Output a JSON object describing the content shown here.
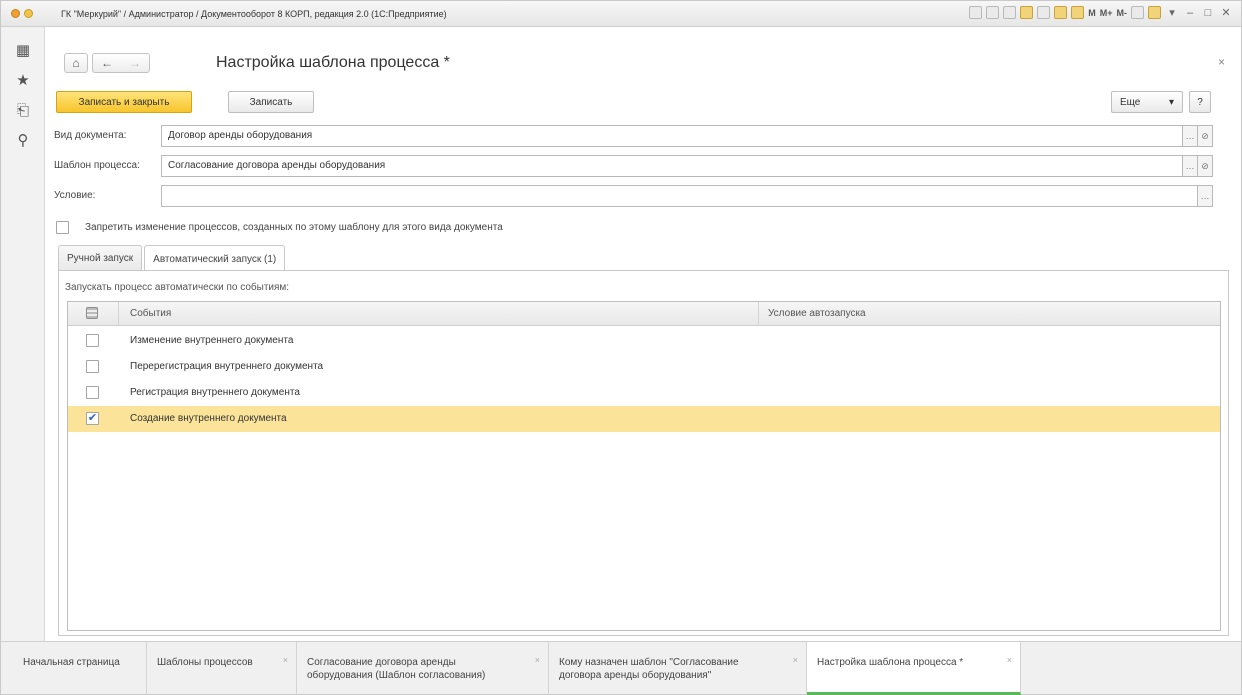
{
  "window": {
    "title": "ГК \"Меркурий\" / Администратор / Документооборот 8 КОРП, редакция 2.0 (1С:Предприятие)",
    "toolbar_labels": [
      "M",
      "M+",
      "M-"
    ]
  },
  "sidebar": {
    "items": [
      {
        "name": "apps-grid-icon",
        "glyph": "▦"
      },
      {
        "name": "favorites-star-icon",
        "glyph": "★"
      },
      {
        "name": "history-icon",
        "glyph": "⎗"
      },
      {
        "name": "search-icon",
        "glyph": "⚲"
      }
    ]
  },
  "form": {
    "title": "Настройка шаблона процесса *",
    "save_close_label": "Записать и закрыть",
    "save_label": "Записать",
    "more_label": "Еще",
    "help_label": "?",
    "fields": {
      "doc_type_label": "Вид документа:",
      "doc_type_value": "Договор аренды оборудования",
      "template_label": "Шаблон процесса:",
      "template_value": "Согласование договора аренды оборудования",
      "condition_label": "Условие:",
      "condition_value": ""
    },
    "forbid_checkbox_label": "Запретить изменение процессов, созданных по этому шаблону для этого вида документа",
    "tabs": [
      {
        "label": "Ручной запуск"
      },
      {
        "label": "Автоматический запуск (1)"
      }
    ],
    "panel_caption": "Запускать процесс автоматически по событиям:",
    "grid": {
      "columns": [
        "События",
        "Условие автозапуска"
      ],
      "rows": [
        {
          "event": "Изменение внутреннего документа",
          "checked": false,
          "selected": false
        },
        {
          "event": "Перерегистрация внутреннего документа",
          "checked": false,
          "selected": false
        },
        {
          "event": "Регистрация внутреннего документа",
          "checked": false,
          "selected": false
        },
        {
          "event": "Создание внутреннего документа",
          "checked": true,
          "selected": true
        }
      ]
    }
  },
  "taskbar": {
    "tabs": [
      {
        "label": "Начальная страница",
        "active": false
      },
      {
        "label": "Шаблоны процессов",
        "active": false
      },
      {
        "label": "Согласование договора аренды оборудования (Шаблон согласования)",
        "active": false
      },
      {
        "label": "Кому назначен шаблон \"Согласование договора аренды оборудования\"",
        "active": false
      },
      {
        "label": "Настройка шаблона процесса *",
        "active": true
      }
    ]
  },
  "colors": {
    "primary_button": "#f7c52b",
    "selected_row": "#fbe49a",
    "active_tab_underline": "#58b95a"
  }
}
